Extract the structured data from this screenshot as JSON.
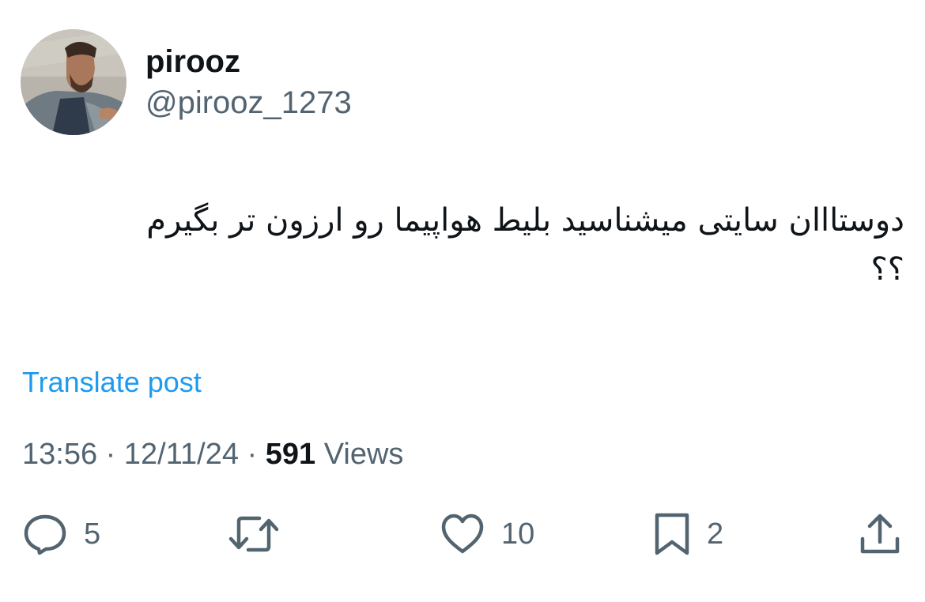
{
  "author": {
    "display_name": "pirooz",
    "handle": "@pirooz_1273"
  },
  "post": {
    "text": "دوستااان سایتی میشناسید بلیط هواپیما رو ارزون تر بگیرم ؟؟",
    "translate_label": "Translate post"
  },
  "meta": {
    "time": "13:56",
    "separator": "·",
    "date": "12/11/24",
    "views_count": "591",
    "views_label": "Views"
  },
  "actions": {
    "replies": {
      "icon": "reply-icon",
      "count": "5"
    },
    "reposts": {
      "icon": "repost-icon",
      "count": ""
    },
    "likes": {
      "icon": "like-icon",
      "count": "10"
    },
    "bookmarks": {
      "icon": "bookmark-icon",
      "count": "2"
    },
    "share": {
      "icon": "share-icon"
    }
  },
  "colors": {
    "text_primary": "#0f1419",
    "text_secondary": "#536471",
    "link": "#1d9bf0",
    "background": "#ffffff"
  }
}
